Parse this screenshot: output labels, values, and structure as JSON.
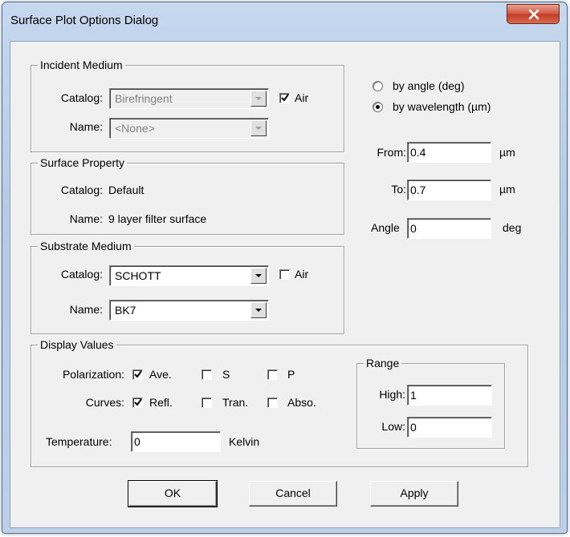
{
  "window": {
    "title": "Surface Plot Options Dialog"
  },
  "incident": {
    "legend": "Incident Medium",
    "catalog_label": "Catalog:",
    "catalog_value": "Birefringent",
    "air_label": "Air",
    "air_checked": true,
    "name_label": "Name:",
    "name_value": "<None>"
  },
  "surface": {
    "legend": "Surface Property",
    "catalog_label": "Catalog:",
    "catalog_value": "Default",
    "name_label": "Name:",
    "name_value": "9 layer filter surface"
  },
  "substrate": {
    "legend": "Substrate Medium",
    "catalog_label": "Catalog:",
    "catalog_value": "SCHOTT",
    "air_label": "Air",
    "air_checked": false,
    "name_label": "Name:",
    "name_value": "BK7"
  },
  "mode": {
    "by_angle_label": "by angle (deg)",
    "by_wavelength_label": "by wavelength (µm)",
    "selected": "by_wavelength"
  },
  "range_inputs": {
    "from_label": "From:",
    "from_value": "0.4",
    "from_unit": "µm",
    "to_label": "To:",
    "to_value": "0.7",
    "to_unit": "µm",
    "angle_label": "Angle",
    "angle_value": "0",
    "angle_unit": "deg"
  },
  "display": {
    "legend": "Display Values",
    "polarization_label": "Polarization:",
    "pol_ave": "Ave.",
    "pol_s": "S",
    "pol_p": "P",
    "curves_label": "Curves:",
    "cur_refl": "Refl.",
    "cur_tran": "Tran.",
    "cur_abso": "Abso.",
    "temperature_label": "Temperature:",
    "temperature_value": "0",
    "temperature_unit": "Kelvin",
    "range_legend": "Range",
    "high_label": "High:",
    "high_value": "1",
    "low_label": "Low:",
    "low_value": "0"
  },
  "buttons": {
    "ok": "OK",
    "cancel": "Cancel",
    "apply": "Apply"
  }
}
